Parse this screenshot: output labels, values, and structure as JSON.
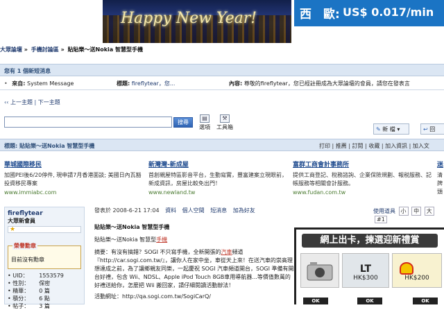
{
  "banner": {
    "left_text": "Happy New Year!",
    "right_country": "西　歐:",
    "right_price": "US$ 0.017/min"
  },
  "breadcrumb": [
    "大眾論壇",
    "»",
    "手機討論區",
    "»",
    "貼貼樂～送Nokia 智慧型手機"
  ],
  "pm": {
    "header": "您有 1 個新短消息",
    "from_label": "來自:",
    "from_value": "System Message",
    "subject_label": "標題:",
    "subject_value": "fireflytear，您...",
    "content_label": "內容:",
    "content_value": "尊敬的fireflytear，您已經註冊成為大眾論壇的會員，請您在發表言"
  },
  "thread_nav": {
    "prev": "上一主題",
    "sep": "|",
    "next": "下一主題",
    "arrow": "‹‹"
  },
  "search": {
    "value": "",
    "button": "搜尋"
  },
  "toolbar": {
    "item1": "選項",
    "item2": "工具箱"
  },
  "actions": {
    "new_label": "新 檔",
    "reply_label": "回"
  },
  "title_bar": {
    "label": "標題: 貼貼樂～送Nokia 智慧型手機",
    "links": "打印 | 推薦 | 訂閱 | 收藏 | 加入資訊 | 加入文"
  },
  "ads": [
    {
      "title": "華城國際移民",
      "desc": "加國PEI後6/20停件, 現申請7月香港面談; 美國日內瓦豁投資移民專案",
      "url": "www.immiabc.com"
    },
    {
      "title": "新灣灣-新成屋",
      "desc": "首創親屋特區影音平台，生動寫實，豐富建案立現眼前，新成資訊，房屋比較免出門！",
      "url": "www.newland.tw"
    },
    {
      "title": "富群工商會計事務所",
      "desc": "提供工商登記、稅務諮詢、企業保險規劃、報税服務、記帳服務等相關會計服務。",
      "url": "www.fudan.com.tw"
    },
    {
      "title": "迷",
      "desc": "清 牌 頭",
      "url": ""
    }
  ],
  "user": {
    "name": "fireflytear",
    "rank": "大眾新會員",
    "stars": "★",
    "medal_title": "榮譽勳章",
    "medal_value": "目前沒有勳章",
    "stats": [
      {
        "k": "UID：",
        "v": "1553579"
      },
      {
        "k": "性別：",
        "v": "保密"
      },
      {
        "k": "精華：",
        "v": "0 篇"
      },
      {
        "k": "積分：",
        "v": "6 點"
      },
      {
        "k": "帖子：",
        "v": "3 篇"
      }
    ]
  },
  "post": {
    "meta": [
      "發表於 2008-6-21 17:04",
      "資料",
      "個人空間",
      "短消息",
      "加為好友"
    ],
    "tools_label": "使用道具",
    "tools_sizes": [
      "小",
      "中",
      "大"
    ],
    "floor": "#1",
    "title": "貼貼樂～送Nokia 智慧型手機",
    "line1_pre": "貼貼樂～送Nokia 智慧型",
    "line1_red": "手機",
    "summary_a": "摘要：有沒有搞錯？SOGI 不只寫手機，全新開張的",
    "summary_red": "汽車",
    "summary_b": "頻道『http://car.sogi.com.tw/』，讓你人在家中坐，車從天上來！在送汽車的崇高理想達成之前，為了讓鄉親友同樂，一起慶祝 SOGI 汽車頻道開台，SOGI 準備有開台好禮，包含 Wii、NDSL、Apple iPod Touch 8GB車用導航器...等價值數萬的好禮送給你，怎麼把 Wii 搬回家，請仔細閱讀活動辦法！",
    "link": "活動網址：http://qa.sogi.com.tw/SogiCarQ/"
  },
  "popup": {
    "header": "網上出卡，揀選迎新禮賞",
    "lt": "LT",
    "lt_price": "HK$300",
    "shell_price": "HK$200",
    "ok": "OK"
  }
}
